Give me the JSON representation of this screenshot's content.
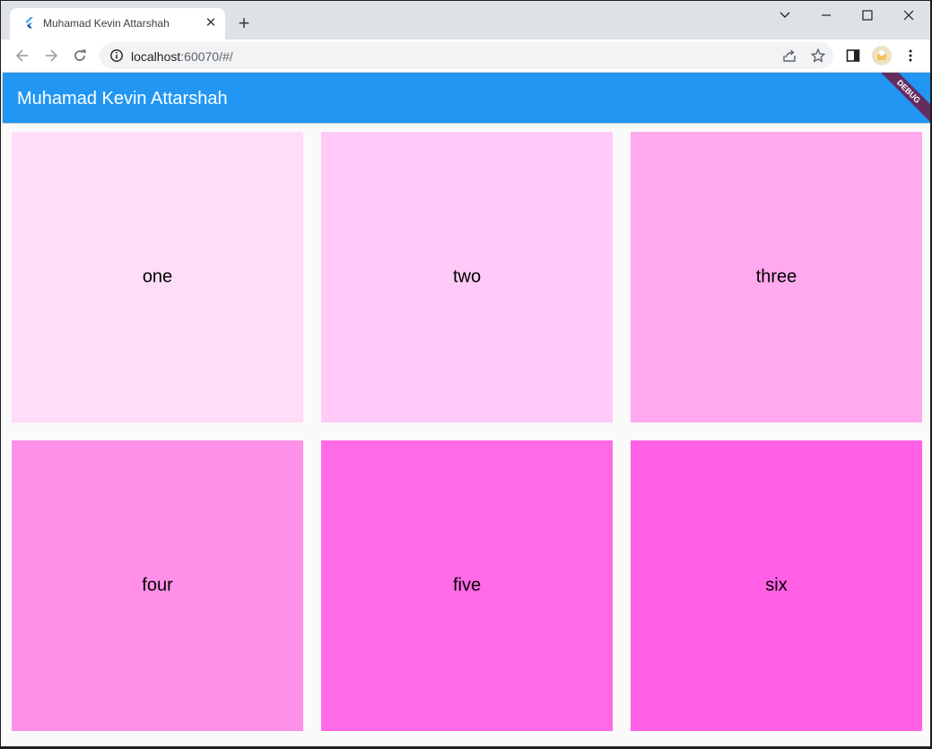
{
  "browser": {
    "tab_title": "Muhamad Kevin Attarshah",
    "tab_favicon": "flutter-logo-icon",
    "url_host": "localhost",
    "url_rest": ":60070/#/"
  },
  "app": {
    "title": "Muhamad Kevin Attarshah",
    "debug_label": "DEBUG",
    "appbar_color": "#2196f3"
  },
  "grid": {
    "items": [
      {
        "label": "one",
        "color": "#ffdcf7"
      },
      {
        "label": "two",
        "color": "#ffcaf7"
      },
      {
        "label": "three",
        "color": "#ffaaee"
      },
      {
        "label": "four",
        "color": "#ff90e9"
      },
      {
        "label": "five",
        "color": "#ff6ae6"
      },
      {
        "label": "six",
        "color": "#ff60e6"
      }
    ]
  }
}
